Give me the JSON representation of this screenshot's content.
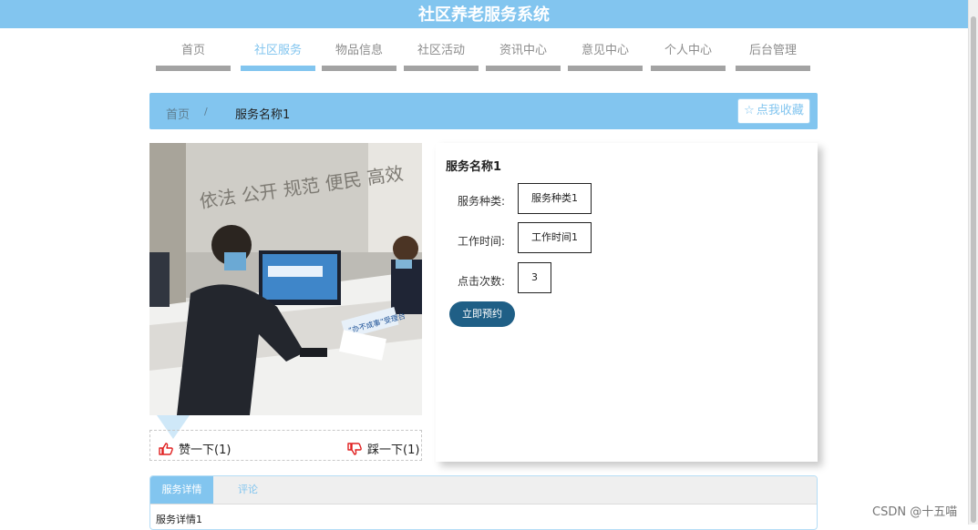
{
  "app": {
    "title": "社区养老服务系统"
  },
  "nav": {
    "items": [
      {
        "label": "首页"
      },
      {
        "label": "社区服务"
      },
      {
        "label": "物品信息"
      },
      {
        "label": "社区活动"
      },
      {
        "label": "资讯中心"
      },
      {
        "label": "意见中心"
      },
      {
        "label": "个人中心"
      },
      {
        "label": "后台管理"
      }
    ],
    "active_label": "社区服务"
  },
  "breadcrumb": {
    "home": "首页",
    "separator": "/",
    "current": "服务名称1"
  },
  "favorite": {
    "label": "点我收藏",
    "icon": "star-outline-icon"
  },
  "service": {
    "name": "服务名称1",
    "fields": [
      {
        "label": "服务种类:",
        "value": "服务种类1"
      },
      {
        "label": "工作时间:",
        "value": "工作时间1"
      },
      {
        "label": "点击次数:",
        "value": "3"
      }
    ],
    "book_label": "立即预约"
  },
  "photo": {
    "sign_text": "“办不成事”受理台"
  },
  "votes": {
    "up_label": "赞一下(1)",
    "down_label": "踩一下(1)",
    "up_icon": "thumbs-up-icon",
    "down_icon": "thumbs-down-icon"
  },
  "tabs": {
    "items": [
      {
        "label": "服务详情"
      },
      {
        "label": "评论"
      }
    ],
    "detail_text": "服务详情1"
  },
  "watermark": "CSDN @十五喵",
  "colors": {
    "accent": "#82c5ef",
    "button_dark": "#1f5f86",
    "vote_icon": "#e02020",
    "nav_bar": "#a3a3a3"
  }
}
